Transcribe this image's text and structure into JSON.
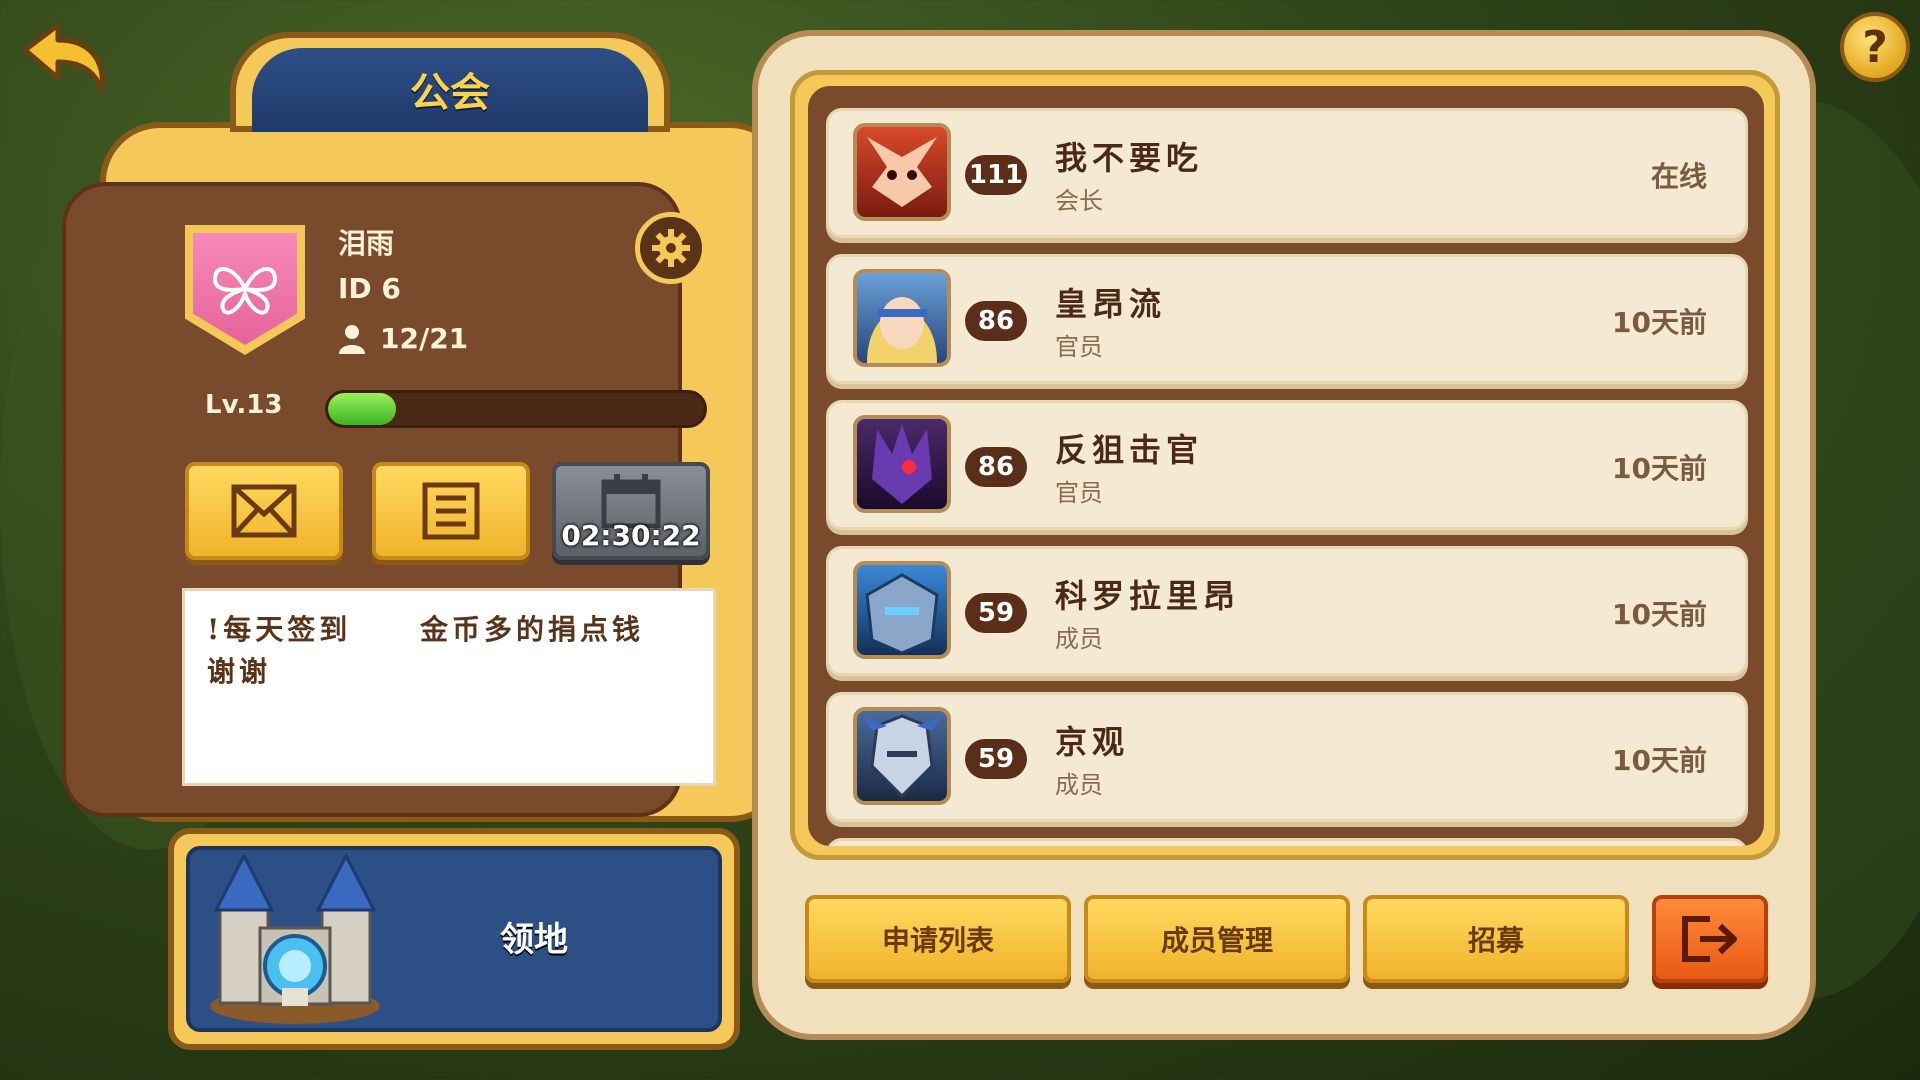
{
  "header": {
    "title": "公会",
    "help_label": "?"
  },
  "guild": {
    "name": "泪雨",
    "id_text": "ID   6",
    "members_text": "12/21",
    "level_text": "Lv.13",
    "level_progress": 0.18,
    "timer_text": "02:30:22",
    "notice": "!每天签到     金币多的捐点钱\n谢谢"
  },
  "territory": {
    "label": "领地"
  },
  "members": [
    {
      "name": "我不要吃",
      "role": "会长",
      "level": "111",
      "status": "在线"
    },
    {
      "name": "皇昂流",
      "role": "官员",
      "level": "86",
      "status": "10天前"
    },
    {
      "name": "反狙击官",
      "role": "官员",
      "level": "86",
      "status": "10天前"
    },
    {
      "name": "科罗拉里昂",
      "role": "成员",
      "level": "59",
      "status": "10天前"
    },
    {
      "name": "京观",
      "role": "成员",
      "level": "59",
      "status": "10天前"
    }
  ],
  "actions": {
    "apply_list": "申请列表",
    "member_management": "成员管理",
    "recruit": "招募"
  },
  "icons": {
    "back": "back-arrow-icon",
    "help": "question-icon",
    "settings": "gear-icon",
    "mail": "mail-icon",
    "log": "list-icon",
    "calendar": "calendar-icon",
    "exit": "exit-icon"
  }
}
